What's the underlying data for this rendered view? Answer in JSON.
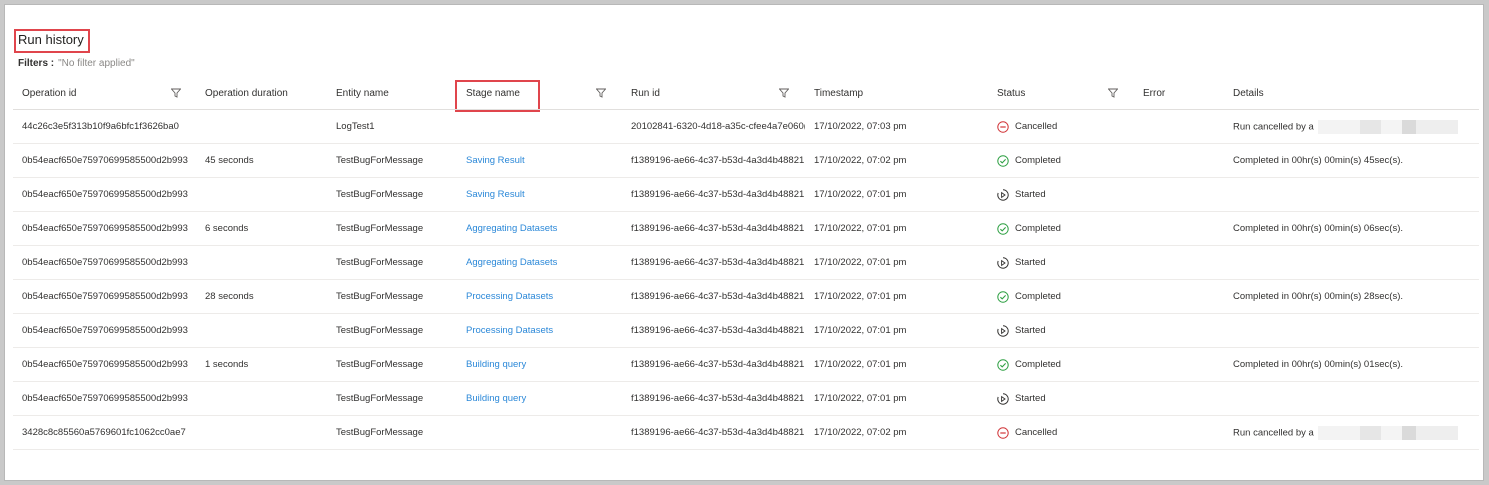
{
  "page": {
    "title": "Run history",
    "filters_label": "Filters :",
    "filters_value": "\"No filter applied\""
  },
  "columns": {
    "operation_id": "Operation id",
    "operation_duration": "Operation duration",
    "entity_name": "Entity name",
    "stage_name": "Stage name",
    "run_id": "Run id",
    "timestamp": "Timestamp",
    "status": "Status",
    "error": "Error",
    "details": "Details"
  },
  "colors": {
    "completed": "#2ea043",
    "cancelled": "#d13438",
    "started": "#323130",
    "link": "#2b88d8",
    "highlight": "#e0454c"
  },
  "rows": [
    {
      "operation_id": "44c26c3e5f313b10f9a6bfc1f3626ba0",
      "duration": "",
      "entity": "LogTest1",
      "stage": "",
      "run_id": "20102841-6320-4d18-a35c-cfee4a7e060(",
      "timestamp": "17/10/2022, 07:03 pm",
      "status": "Cancelled",
      "status_icon": "cancelled-icon",
      "error": "",
      "details": "Run cancelled by a"
    },
    {
      "operation_id": "0b54eacf650e75970699585500d2b993",
      "duration": "45 seconds",
      "entity": "TestBugForMessage",
      "stage": "Saving Result",
      "run_id": "f1389196-ae66-4c37-b53d-4a3d4b48821",
      "timestamp": "17/10/2022, 07:02 pm",
      "status": "Completed",
      "status_icon": "completed-icon",
      "error": "",
      "details": "Completed in 00hr(s) 00min(s) 45sec(s)."
    },
    {
      "operation_id": "0b54eacf650e75970699585500d2b993",
      "duration": "",
      "entity": "TestBugForMessage",
      "stage": "Saving Result",
      "run_id": "f1389196-ae66-4c37-b53d-4a3d4b48821",
      "timestamp": "17/10/2022, 07:01 pm",
      "status": "Started",
      "status_icon": "started-icon",
      "error": "",
      "details": ""
    },
    {
      "operation_id": "0b54eacf650e75970699585500d2b993",
      "duration": "6 seconds",
      "entity": "TestBugForMessage",
      "stage": "Aggregating Datasets",
      "run_id": "f1389196-ae66-4c37-b53d-4a3d4b48821",
      "timestamp": "17/10/2022, 07:01 pm",
      "status": "Completed",
      "status_icon": "completed-icon",
      "error": "",
      "details": "Completed in 00hr(s) 00min(s) 06sec(s)."
    },
    {
      "operation_id": "0b54eacf650e75970699585500d2b993",
      "duration": "",
      "entity": "TestBugForMessage",
      "stage": "Aggregating Datasets",
      "run_id": "f1389196-ae66-4c37-b53d-4a3d4b48821",
      "timestamp": "17/10/2022, 07:01 pm",
      "status": "Started",
      "status_icon": "started-icon",
      "error": "",
      "details": ""
    },
    {
      "operation_id": "0b54eacf650e75970699585500d2b993",
      "duration": "28 seconds",
      "entity": "TestBugForMessage",
      "stage": "Processing Datasets",
      "run_id": "f1389196-ae66-4c37-b53d-4a3d4b48821",
      "timestamp": "17/10/2022, 07:01 pm",
      "status": "Completed",
      "status_icon": "completed-icon",
      "error": "",
      "details": "Completed in 00hr(s) 00min(s) 28sec(s)."
    },
    {
      "operation_id": "0b54eacf650e75970699585500d2b993",
      "duration": "",
      "entity": "TestBugForMessage",
      "stage": "Processing Datasets",
      "run_id": "f1389196-ae66-4c37-b53d-4a3d4b48821",
      "timestamp": "17/10/2022, 07:01 pm",
      "status": "Started",
      "status_icon": "started-icon",
      "error": "",
      "details": ""
    },
    {
      "operation_id": "0b54eacf650e75970699585500d2b993",
      "duration": "1 seconds",
      "entity": "TestBugForMessage",
      "stage": "Building query",
      "run_id": "f1389196-ae66-4c37-b53d-4a3d4b48821",
      "timestamp": "17/10/2022, 07:01 pm",
      "status": "Completed",
      "status_icon": "completed-icon",
      "error": "",
      "details": "Completed in 00hr(s) 00min(s) 01sec(s)."
    },
    {
      "operation_id": "0b54eacf650e75970699585500d2b993",
      "duration": "",
      "entity": "TestBugForMessage",
      "stage": "Building query",
      "run_id": "f1389196-ae66-4c37-b53d-4a3d4b48821",
      "timestamp": "17/10/2022, 07:01 pm",
      "status": "Started",
      "status_icon": "started-icon",
      "error": "",
      "details": ""
    },
    {
      "operation_id": "3428c8c85560a5769601fc1062cc0ae7",
      "duration": "",
      "entity": "TestBugForMessage",
      "stage": "",
      "run_id": "f1389196-ae66-4c37-b53d-4a3d4b48821",
      "timestamp": "17/10/2022, 07:02 pm",
      "status": "Cancelled",
      "status_icon": "cancelled-icon",
      "error": "",
      "details": "Run cancelled by a"
    }
  ]
}
